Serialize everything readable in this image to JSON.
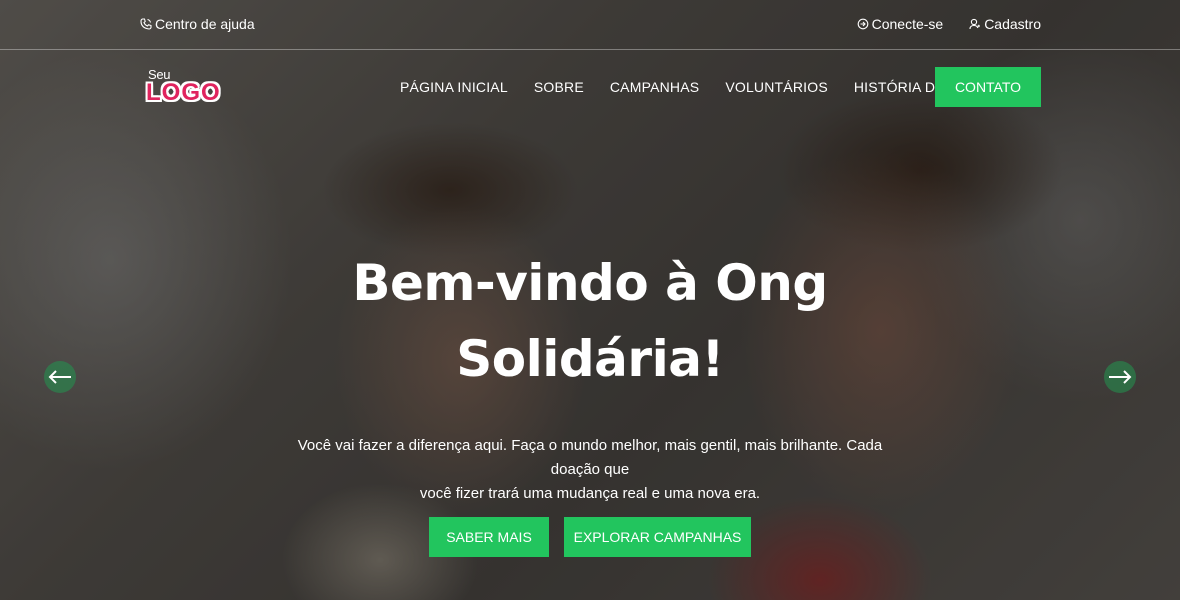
{
  "topbar": {
    "help_label": "Centro de ajuda",
    "help_icon": "phone-icon",
    "login_label": "Conecte-se",
    "login_icon": "login-icon",
    "signup_label": "Cadastro",
    "signup_icon": "user-icon"
  },
  "logo": {
    "small": "Seu",
    "main": "LOGO"
  },
  "nav": {
    "items": [
      "PÁGINA INICIAL",
      "SOBRE",
      "CAMPANHAS",
      "VOLUNTÁRIOS",
      "HISTÓRIA DE SUCESSO"
    ],
    "contact_label": "CONTATO"
  },
  "hero": {
    "title_line1": "Bem-vindo à Ong",
    "title_line2": "Solidária!",
    "subtitle_line1": "Você vai fazer a diferença aqui. Faça o mundo melhor, mais gentil, mais brilhante. Cada doação que",
    "subtitle_line2": "você fizer trará uma mudança real e uma nova era.",
    "cta_primary": "SABER MAIS",
    "cta_secondary": "EXPLORAR CAMPANHAS"
  },
  "slider": {
    "prev_icon": "arrow-left-icon",
    "next_icon": "arrow-right-icon"
  },
  "colors": {
    "accent": "#22c55e",
    "logo": "#e0245e",
    "text": "#ffffff"
  }
}
